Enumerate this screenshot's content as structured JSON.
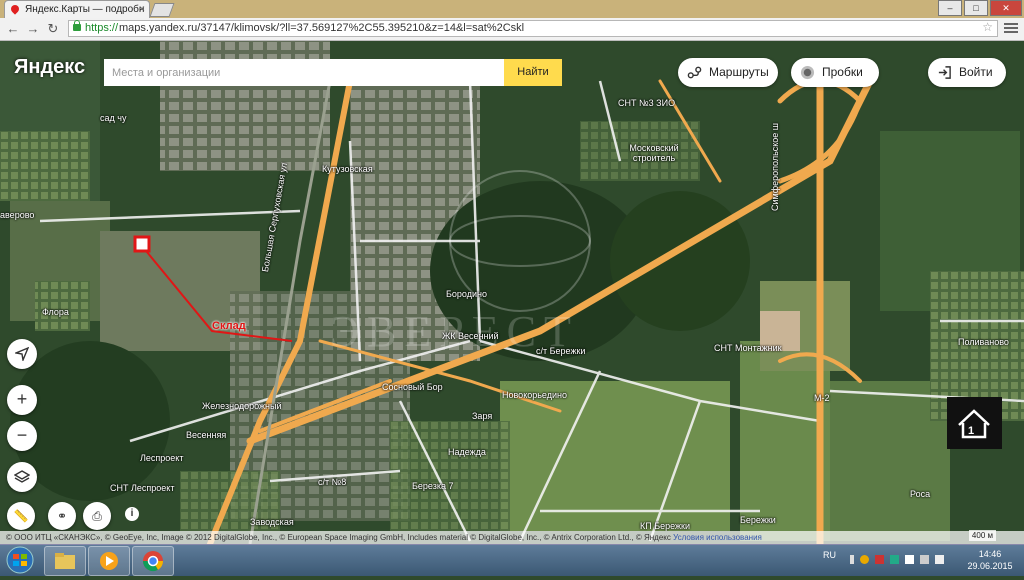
{
  "browser": {
    "tab_title": "Яндекс.Карты — подробн",
    "url_scheme": "https://",
    "url_rest": "maps.yandex.ru/37147/klimovsk/?ll=37.569127%2C55.395210&z=14&l=sat%2Cskl",
    "window_buttons": [
      "–",
      "□",
      "✕"
    ]
  },
  "map": {
    "logo": "Яндекс",
    "search_placeholder": "Места и организации",
    "find_label": "Найти",
    "routes_label": "Маршруты",
    "traffic_label": "Пробки",
    "login_label": "Войти",
    "marker_label": "Склад",
    "scale_label": "400 м",
    "attribution": "© ООО ИТЦ «СКАНЭКС», © GeoEye, Inc, Image © 2012 DigitalGlobe, Inc., © European Space Imaging GmbH, Includes material © DigitalGlobe, Inc., © Antrix Corporation Ltd., © Яндекс",
    "terms_label": "Условия использования",
    "places": [
      {
        "name": "сад чу"
      },
      {
        "name": "Кутузовская"
      },
      {
        "name": "аверово"
      },
      {
        "name": "Флора"
      },
      {
        "name": "СНТ №3 ЗИО"
      },
      {
        "name": "Московский строитель"
      },
      {
        "name": "Симферопольское ш"
      },
      {
        "name": "Большая Серпуховская ул"
      },
      {
        "name": "Бородино"
      },
      {
        "name": "ЖК Весенний"
      },
      {
        "name": "с/т Бережки"
      },
      {
        "name": "Сосновый Бор"
      },
      {
        "name": "Новокорьедино"
      },
      {
        "name": "Заря"
      },
      {
        "name": "Железнодорожный"
      },
      {
        "name": "Весенняя"
      },
      {
        "name": "Надежда"
      },
      {
        "name": "Леспроект"
      },
      {
        "name": "СНТ Леспроект"
      },
      {
        "name": "с/т №8"
      },
      {
        "name": "Березка 7"
      },
      {
        "name": "Заводская"
      },
      {
        "name": "СНТ Монтажник"
      },
      {
        "name": "Поливаново"
      },
      {
        "name": "М-2"
      },
      {
        "name": "Роса"
      },
      {
        "name": "Бережки"
      },
      {
        "name": "КП Бережки"
      }
    ]
  },
  "taskbar": {
    "lang": "RU",
    "time": "14:46",
    "date": "29.06.2015"
  },
  "colors": {
    "find_button": "#ffdb4d",
    "marker": "#e01616",
    "road": "#f0a94e"
  }
}
